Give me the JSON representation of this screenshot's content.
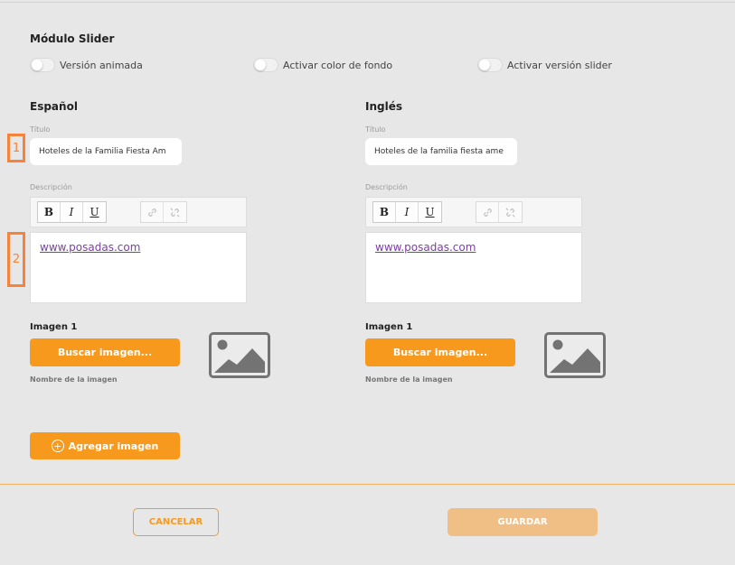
{
  "module": {
    "title": "Módulo Slider"
  },
  "toggles": [
    {
      "label": "Versión animada",
      "on": false
    },
    {
      "label": "Activar color de fondo",
      "on": false
    },
    {
      "label": "Activar versión slider",
      "on": false
    }
  ],
  "spanish": {
    "heading": "Español",
    "title_label": "Título",
    "title_value": "Hoteles de la Familia Fiesta Am",
    "description_label": "Descripción",
    "description_link": "www.posadas.com",
    "image_label": "Imagen 1",
    "search_button": "Buscar imagen...",
    "image_name_label": "Nombre de la imagen"
  },
  "english": {
    "heading": "Inglés",
    "title_label": "Título",
    "title_value": "Hoteles de la familia fiesta ame",
    "description_label": "Descripción",
    "description_link": "www.posadas.com",
    "image_label": "Imagen 1",
    "search_button": "Buscar imagen...",
    "image_name_label": "Nombre de la imagen"
  },
  "toolbar": {
    "bold": "B",
    "italic": "I",
    "underline": "U"
  },
  "add_image_button": "Agregar imagen",
  "markers": [
    "1",
    "2"
  ],
  "footer": {
    "cancel": "CANCELAR",
    "save": "GUARDAR"
  },
  "colors": {
    "accent": "#f7991c",
    "accent_disabled": "#f0bf85",
    "marker": "#f7833a",
    "link": "#7b3fa0"
  }
}
